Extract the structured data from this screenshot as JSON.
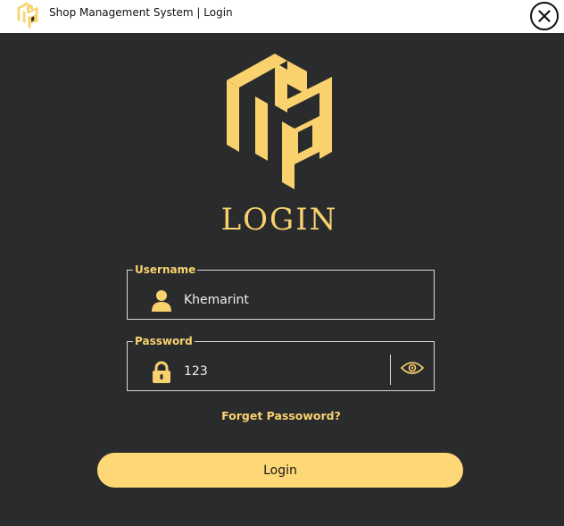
{
  "window": {
    "title": "Shop Management System | Login",
    "close_icon": "close-circle-icon"
  },
  "brand": {
    "logo_icon": "cube-letters-logo",
    "accent_color": "#f9d26e",
    "background_color": "#2a2b2d"
  },
  "login": {
    "heading": "LOGIN",
    "username": {
      "legend": "Username",
      "value": "Khemarint",
      "icon": "user-icon"
    },
    "password": {
      "legend": "Password",
      "value": "123",
      "icon": "lock-icon",
      "toggle_icon": "eye-icon"
    },
    "forgot_link": "Forget Passoword?",
    "submit_label": "Login"
  }
}
